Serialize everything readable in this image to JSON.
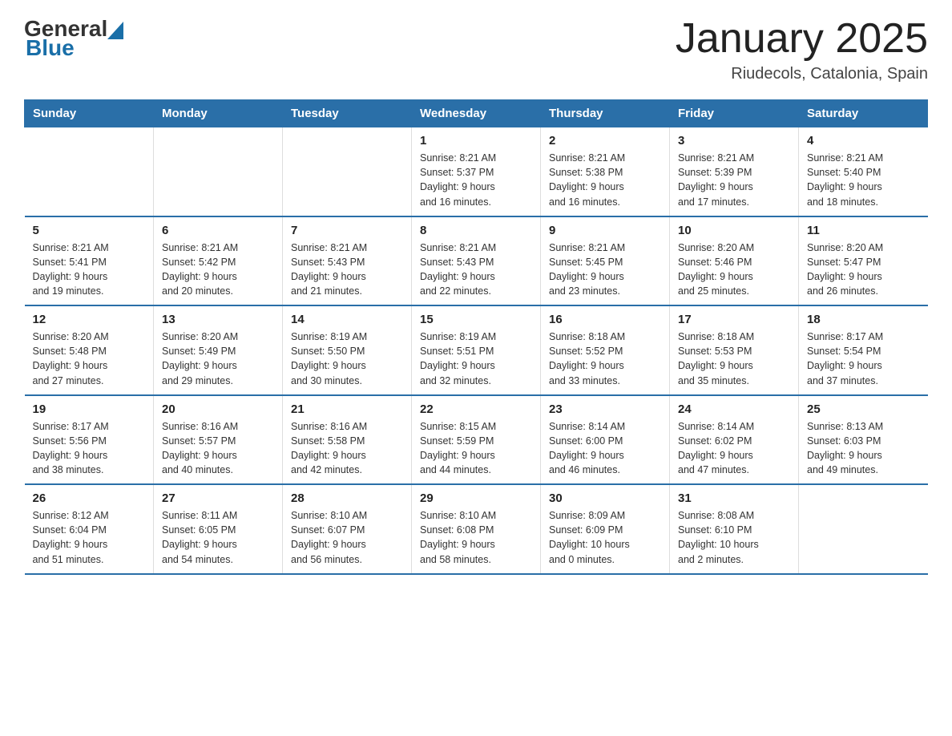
{
  "header": {
    "logo": {
      "general": "General",
      "blue": "Blue"
    },
    "title": "January 2025",
    "location": "Riudecols, Catalonia, Spain"
  },
  "calendar": {
    "days_of_week": [
      "Sunday",
      "Monday",
      "Tuesday",
      "Wednesday",
      "Thursday",
      "Friday",
      "Saturday"
    ],
    "accent_color": "#2a6fa8",
    "weeks": [
      [
        {
          "day": "",
          "info": ""
        },
        {
          "day": "",
          "info": ""
        },
        {
          "day": "",
          "info": ""
        },
        {
          "day": "1",
          "info": "Sunrise: 8:21 AM\nSunset: 5:37 PM\nDaylight: 9 hours\nand 16 minutes."
        },
        {
          "day": "2",
          "info": "Sunrise: 8:21 AM\nSunset: 5:38 PM\nDaylight: 9 hours\nand 16 minutes."
        },
        {
          "day": "3",
          "info": "Sunrise: 8:21 AM\nSunset: 5:39 PM\nDaylight: 9 hours\nand 17 minutes."
        },
        {
          "day": "4",
          "info": "Sunrise: 8:21 AM\nSunset: 5:40 PM\nDaylight: 9 hours\nand 18 minutes."
        }
      ],
      [
        {
          "day": "5",
          "info": "Sunrise: 8:21 AM\nSunset: 5:41 PM\nDaylight: 9 hours\nand 19 minutes."
        },
        {
          "day": "6",
          "info": "Sunrise: 8:21 AM\nSunset: 5:42 PM\nDaylight: 9 hours\nand 20 minutes."
        },
        {
          "day": "7",
          "info": "Sunrise: 8:21 AM\nSunset: 5:43 PM\nDaylight: 9 hours\nand 21 minutes."
        },
        {
          "day": "8",
          "info": "Sunrise: 8:21 AM\nSunset: 5:43 PM\nDaylight: 9 hours\nand 22 minutes."
        },
        {
          "day": "9",
          "info": "Sunrise: 8:21 AM\nSunset: 5:45 PM\nDaylight: 9 hours\nand 23 minutes."
        },
        {
          "day": "10",
          "info": "Sunrise: 8:20 AM\nSunset: 5:46 PM\nDaylight: 9 hours\nand 25 minutes."
        },
        {
          "day": "11",
          "info": "Sunrise: 8:20 AM\nSunset: 5:47 PM\nDaylight: 9 hours\nand 26 minutes."
        }
      ],
      [
        {
          "day": "12",
          "info": "Sunrise: 8:20 AM\nSunset: 5:48 PM\nDaylight: 9 hours\nand 27 minutes."
        },
        {
          "day": "13",
          "info": "Sunrise: 8:20 AM\nSunset: 5:49 PM\nDaylight: 9 hours\nand 29 minutes."
        },
        {
          "day": "14",
          "info": "Sunrise: 8:19 AM\nSunset: 5:50 PM\nDaylight: 9 hours\nand 30 minutes."
        },
        {
          "day": "15",
          "info": "Sunrise: 8:19 AM\nSunset: 5:51 PM\nDaylight: 9 hours\nand 32 minutes."
        },
        {
          "day": "16",
          "info": "Sunrise: 8:18 AM\nSunset: 5:52 PM\nDaylight: 9 hours\nand 33 minutes."
        },
        {
          "day": "17",
          "info": "Sunrise: 8:18 AM\nSunset: 5:53 PM\nDaylight: 9 hours\nand 35 minutes."
        },
        {
          "day": "18",
          "info": "Sunrise: 8:17 AM\nSunset: 5:54 PM\nDaylight: 9 hours\nand 37 minutes."
        }
      ],
      [
        {
          "day": "19",
          "info": "Sunrise: 8:17 AM\nSunset: 5:56 PM\nDaylight: 9 hours\nand 38 minutes."
        },
        {
          "day": "20",
          "info": "Sunrise: 8:16 AM\nSunset: 5:57 PM\nDaylight: 9 hours\nand 40 minutes."
        },
        {
          "day": "21",
          "info": "Sunrise: 8:16 AM\nSunset: 5:58 PM\nDaylight: 9 hours\nand 42 minutes."
        },
        {
          "day": "22",
          "info": "Sunrise: 8:15 AM\nSunset: 5:59 PM\nDaylight: 9 hours\nand 44 minutes."
        },
        {
          "day": "23",
          "info": "Sunrise: 8:14 AM\nSunset: 6:00 PM\nDaylight: 9 hours\nand 46 minutes."
        },
        {
          "day": "24",
          "info": "Sunrise: 8:14 AM\nSunset: 6:02 PM\nDaylight: 9 hours\nand 47 minutes."
        },
        {
          "day": "25",
          "info": "Sunrise: 8:13 AM\nSunset: 6:03 PM\nDaylight: 9 hours\nand 49 minutes."
        }
      ],
      [
        {
          "day": "26",
          "info": "Sunrise: 8:12 AM\nSunset: 6:04 PM\nDaylight: 9 hours\nand 51 minutes."
        },
        {
          "day": "27",
          "info": "Sunrise: 8:11 AM\nSunset: 6:05 PM\nDaylight: 9 hours\nand 54 minutes."
        },
        {
          "day": "28",
          "info": "Sunrise: 8:10 AM\nSunset: 6:07 PM\nDaylight: 9 hours\nand 56 minutes."
        },
        {
          "day": "29",
          "info": "Sunrise: 8:10 AM\nSunset: 6:08 PM\nDaylight: 9 hours\nand 58 minutes."
        },
        {
          "day": "30",
          "info": "Sunrise: 8:09 AM\nSunset: 6:09 PM\nDaylight: 10 hours\nand 0 minutes."
        },
        {
          "day": "31",
          "info": "Sunrise: 8:08 AM\nSunset: 6:10 PM\nDaylight: 10 hours\nand 2 minutes."
        },
        {
          "day": "",
          "info": ""
        }
      ]
    ]
  }
}
